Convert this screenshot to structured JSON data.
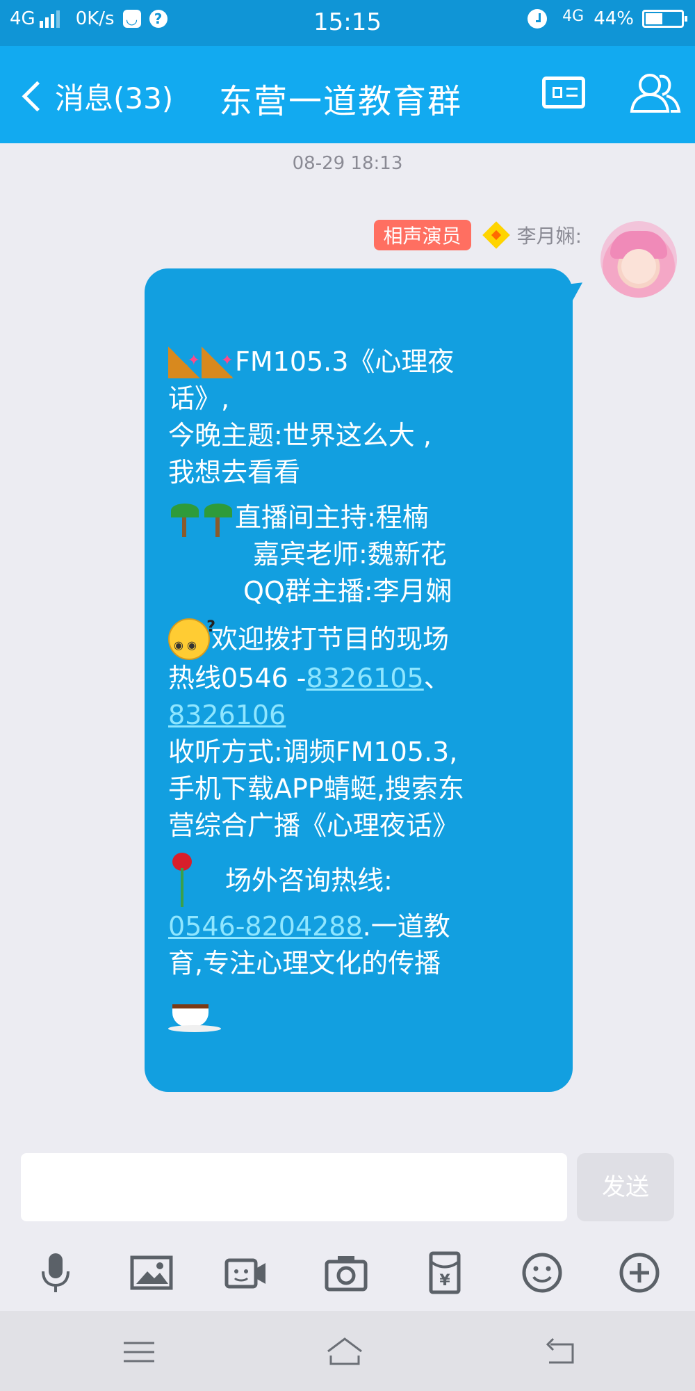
{
  "status_bar": {
    "network": "4G",
    "speed": "0K/s",
    "time": "15:15",
    "network_right": "4G",
    "battery": "44%"
  },
  "header": {
    "back_label": "消息(33)",
    "title": "东营一道教育群",
    "icons": [
      "group-card-icon",
      "group-members-icon"
    ]
  },
  "chat": {
    "timestamp": "08-29 18:13",
    "sender": {
      "badge": "相声演员",
      "name": "李月娴:"
    },
    "message": {
      "l1": "FM105.3《心理夜",
      "l2": "话》,",
      "l3": "今晚主题:世界这么大 ,",
      "l4": "我想去看看",
      "l5": "直播间主持:程楠",
      "l6": "嘉宾老师:魏新花",
      "l7": "QQ群主播:李月娴",
      "l8": "欢迎拨打节目的现场",
      "l9_prefix": "热线0546 - ",
      "phone1": "8326105",
      "l9_suffix": "、",
      "phone2": "8326106",
      "l10": "收听方式:调频FM105.3,",
      "l11": "手机下载APP蜻蜓,搜索东",
      "l12": "营综合广播《心理夜话》",
      "l13": "场外咨询热线:",
      "phone3": "0546-8204288",
      "l14_suffix": ".一道教",
      "l15": "育,专注心理文化的传播"
    }
  },
  "input": {
    "placeholder": "",
    "send_label": "发送"
  },
  "toolbar": [
    "voice-icon",
    "image-icon",
    "video-call-icon",
    "camera-icon",
    "red-packet-icon",
    "emoji-icon",
    "plus-icon"
  ],
  "colors": {
    "status_bar": "#1095d6",
    "title_bar": "#12aaf0",
    "bubble": "#129fe0",
    "badge": "#ff6f61",
    "link": "#8fe6ff"
  }
}
